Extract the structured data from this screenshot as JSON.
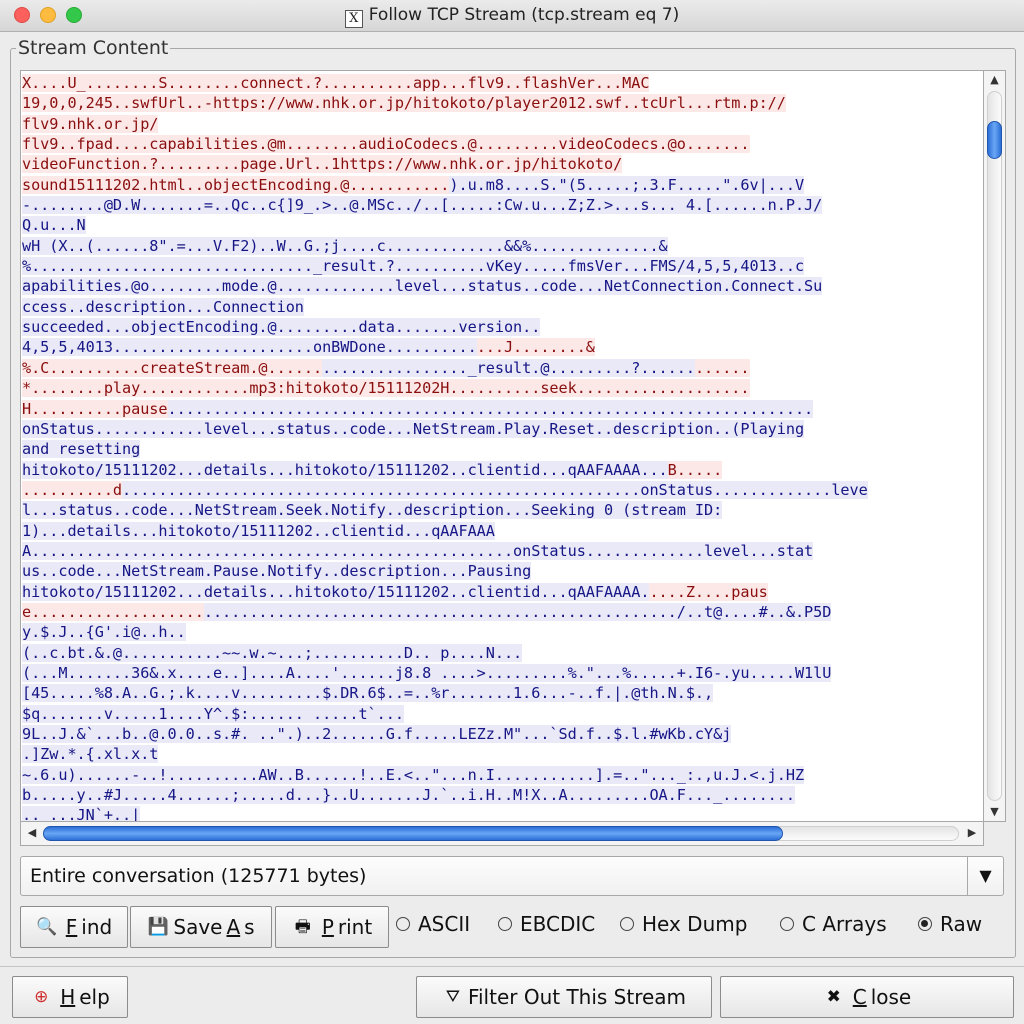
{
  "window": {
    "title": "Follow TCP Stream (tcp.stream eq 7)",
    "app_icon": "X"
  },
  "stream_label": "Stream Content",
  "stream_lines": [
    [
      [
        "c",
        "X....U_........S........connect.?..........app...flv9..flashVer...MAC"
      ]
    ],
    [
      [
        "c",
        "19,0,0,245..swfUrl..-https://www.nhk.or.jp/hitokoto/player2012.swf..tcUrl...rtm.p://"
      ]
    ],
    [
      [
        "c",
        "flv9.nhk.or.jp/"
      ]
    ],
    [
      [
        "c",
        "flv9..fpad....capabilities.@m........audioCodecs.@.........videoCodecs.@o......."
      ]
    ],
    [
      [
        "c",
        "videoFunction.?.........page.Url..1https://www.nhk.or.jp/hitokoto/"
      ]
    ],
    [
      [
        "c",
        "sound15111202.html..objectEncoding.@..........."
      ],
      [
        "s",
        ").u.m8....S.\"(5.....;.3.F.....\".6v|...V"
      ]
    ],
    [
      [
        "s",
        "-........@D.W.......=..Qc..c{]9_.>..@.MSc../..[.....:Cw.u...Z;Z.>...s... 4.[......n.P.J/"
      ]
    ],
    [
      [
        "s",
        "Q.u...N"
      ]
    ],
    [
      [
        "s",
        "wH (X..(......8\".=...V.F2)..W..G.;j....c.............&&%..............&"
      ]
    ],
    [
      [
        "s",
        "%..............................._result.?..........vKey.....fmsVer...FMS/4,5,5,4013..c"
      ]
    ],
    [
      [
        "s",
        "apabilities.@o........mode.@.............level...status..code...NetConnection.Connect.Su"
      ]
    ],
    [
      [
        "s",
        "ccess..description...Connection"
      ]
    ],
    [
      [
        "s",
        "succeeded...objectEncoding.@.........data.......version.."
      ]
    ],
    [
      [
        "s",
        "4,5,5,4013......................onBWDone.........."
      ],
      [
        "c",
        "...J........&"
      ]
    ],
    [
      [
        "c",
        "%.C..........createStream.@......"
      ],
      [
        "s",
        "................_result.@.........?......"
      ],
      [
        "c",
        "......"
      ]
    ],
    [
      [
        "c",
        "*........play............mp3:hitokoto/15111202H..........seek..................."
      ]
    ],
    [
      [
        "c",
        "H..........pause"
      ],
      [
        "s",
        "......................................................................."
      ]
    ],
    [
      [
        "s",
        "onStatus............level...status..code...NetStream.Play.Reset..description..(Playing"
      ]
    ],
    [
      [
        "s",
        "and resetting"
      ]
    ],
    [
      [
        "s",
        "hitokoto/15111202...details...hitokoto/15111202..clientid...qAAFAAAA..."
      ],
      [
        "c",
        "B....."
      ]
    ],
    [
      [
        "c",
        "..........d"
      ],
      [
        "s",
        ".........................................................onStatus.............leve"
      ]
    ],
    [
      [
        "s",
        "l...status..code...NetStream.Seek.Notify..description...Seeking 0 (stream ID:"
      ]
    ],
    [
      [
        "s",
        "1)...details...hitokoto/15111202..clientid...qAAFAAA"
      ]
    ],
    [
      [
        "s",
        "A.....................................................onStatus.............level...stat"
      ]
    ],
    [
      [
        "s",
        "us..code...NetStream.Pause.Notify..description...Pausing"
      ]
    ],
    [
      [
        "s",
        "hitokoto/15111202...details...hitokoto/15111202..clientid...qAAFAAAA."
      ],
      [
        "c",
        "....Z....paus"
      ]
    ],
    [
      [
        "c",
        "e..................."
      ],
      [
        "s",
        "..................................................../..t@....#..&.P5D"
      ]
    ],
    [
      [
        "s",
        "y.$.J..{G'.i@..h.."
      ]
    ],
    [
      [
        "s",
        "(..c.bt.&.@...........~~.w.~...;..........D.. p....N..."
      ]
    ],
    [
      [
        "s",
        "(...M.......36&.x....e..]....A....'......j8.8 ....>.........%.\"...%.....+.I6-.yu.....W1lU"
      ]
    ],
    [
      [
        "s",
        "[45.....%8.A..G.;.k....v.........$.DR.6$..=..%r.......1.6...-..f.|.@th.N.$.,"
      ]
    ],
    [
      [
        "s",
        "$q.......v.....1....Y^.$:...... .....t`..."
      ]
    ],
    [
      [
        "s",
        "9L..J.&`...b..@.0.0..s.#. ..\".)..2......G.f.....LEZz.M\"...`Sd.f..$.l.#wKb.cY&j"
      ]
    ],
    [
      [
        "s",
        ".]Zw.*.{.xl.x.t"
      ]
    ],
    [
      [
        "s",
        "~.6.u)......-..!..........AW..B......!..E.<..\"...n.I...........].=..\"..._:.,u.J.<.j.HZ"
      ]
    ],
    [
      [
        "s",
        "b.....y..#J.....4......;.....d...}..U.......J.`..i.H..M!X..A.........OA.F..._........"
      ]
    ],
    [
      [
        "s",
        ".. ...JN`+..|"
      ]
    ]
  ],
  "conversation_select": {
    "value": "Entire conversation (125771 bytes)"
  },
  "buttons": {
    "find": {
      "pre": "",
      "key": "F",
      "post": "ind"
    },
    "save_as": {
      "pre": "Save ",
      "key": "A",
      "post": "s"
    },
    "print": {
      "pre": "",
      "key": "P",
      "post": "rint"
    },
    "help": {
      "pre": "",
      "key": "H",
      "post": "elp"
    },
    "filter_out": "Filter Out This Stream",
    "close": {
      "pre": "",
      "key": "C",
      "post": "lose"
    }
  },
  "formats": [
    {
      "label": "ASCII",
      "selected": false
    },
    {
      "label": "EBCDIC",
      "selected": false
    },
    {
      "label": "Hex Dump",
      "selected": false
    },
    {
      "label": "C Arrays",
      "selected": false
    },
    {
      "label": "Raw",
      "selected": true
    }
  ],
  "colors": {
    "client": "#8a0e0e",
    "client_bg": "#fde8e8",
    "server": "#161686",
    "server_bg": "#e9e9f8"
  }
}
